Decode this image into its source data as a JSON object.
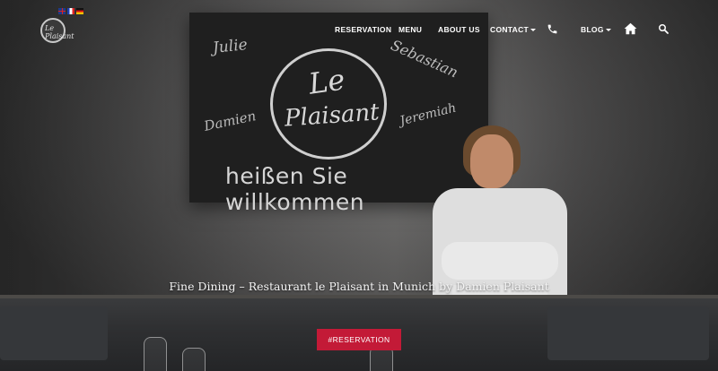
{
  "brand": {
    "logo_text": "Le Plaisant"
  },
  "languages": [
    {
      "code": "en",
      "icon": "uk-flag-icon"
    },
    {
      "code": "fr",
      "icon": "fr-flag-icon"
    },
    {
      "code": "de",
      "icon": "de-flag-icon"
    }
  ],
  "nav": {
    "reservation": "RESERVATION",
    "menu": "MENU",
    "about": "ABOUT US",
    "contact": "CONTACT",
    "blog": "BLOG",
    "icons": [
      "phone-icon",
      "home-icon",
      "search-icon"
    ]
  },
  "chalkboard": {
    "names": [
      "Julie",
      "Sebastian",
      "Damien",
      "Jeremiah"
    ],
    "logo_le": "Le",
    "logo_name": "Plaisant",
    "welcome": "heißen Sie willkommen"
  },
  "hero": {
    "title": "Fine Dining – Restaurant le Plaisant in Munich by Damien Plaisant",
    "cta_label": "#RESERVATION",
    "cta_color": "#c31a37"
  }
}
